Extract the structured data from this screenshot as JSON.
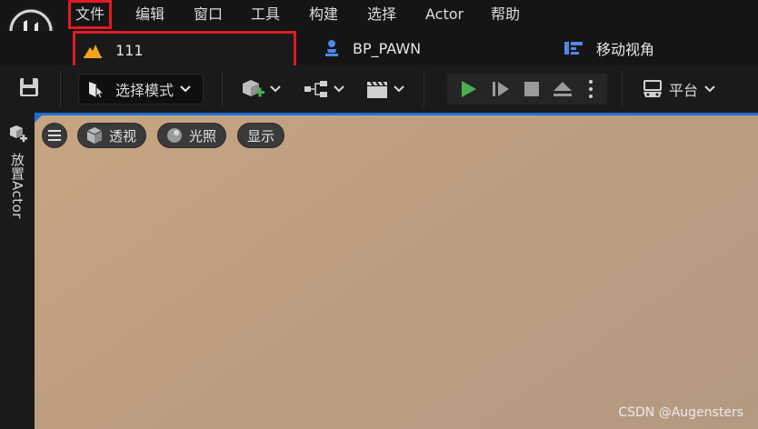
{
  "menu": {
    "items": [
      "文件",
      "编辑",
      "窗口",
      "工具",
      "构建",
      "选择",
      "Actor",
      "帮助"
    ]
  },
  "tabs": [
    {
      "label": "111",
      "icon": "level-icon"
    },
    {
      "label": "BP_PAWN",
      "icon": "pawn-icon"
    },
    {
      "label": "移动视角",
      "icon": "blueprint-icon"
    }
  ],
  "toolbar": {
    "mode_label": "选择模式",
    "platform_label": "平台"
  },
  "left_panel": {
    "place_actor_label": "放置Actor"
  },
  "viewport": {
    "buttons": {
      "perspective": "透视",
      "lighting": "光照",
      "show": "显示"
    },
    "watermark": "CSDN @Augensters"
  },
  "colors": {
    "highlight_red": "#e01b24",
    "play_green": "#4caf50",
    "viewport_blue": "#1f6fd6",
    "viewport_bg": "#c0a080"
  }
}
